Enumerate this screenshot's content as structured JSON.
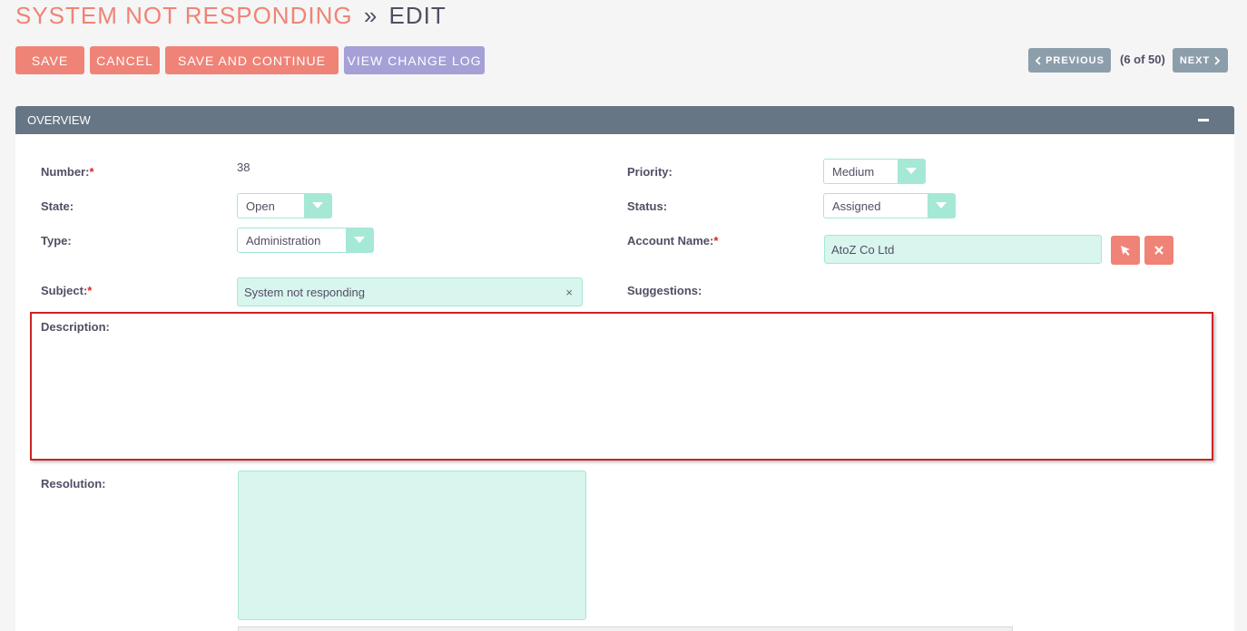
{
  "title": {
    "module": "SYSTEM NOT RESPONDING",
    "separator": "»",
    "action": "EDIT"
  },
  "actions": {
    "save": "SAVE",
    "cancel": "CANCEL",
    "save_continue": "SAVE AND CONTINUE",
    "change_log": "VIEW CHANGE LOG"
  },
  "pagination": {
    "previous": "PREVIOUS",
    "count": "(6 of 50)",
    "next": "NEXT"
  },
  "panel": {
    "title": "OVERVIEW"
  },
  "fields": {
    "number": {
      "label": "Number:",
      "required": "*",
      "value": "38"
    },
    "priority": {
      "label": "Priority:",
      "value": "Medium"
    },
    "state": {
      "label": "State:",
      "value": "Open"
    },
    "status": {
      "label": "Status:",
      "value": "Assigned"
    },
    "type": {
      "label": "Type:",
      "value": "Administration"
    },
    "account_name": {
      "label": "Account Name:",
      "required": "*",
      "value": "AtoZ Co Ltd"
    },
    "subject": {
      "label": "Subject:",
      "required": "*",
      "value": "System not responding",
      "clear": "×"
    },
    "suggestions": {
      "label": "Suggestions:"
    },
    "description": {
      "label": "Description:"
    },
    "resolution": {
      "label": "Resolution:",
      "value": ""
    }
  },
  "icons": {
    "select": "cursor-arrow-icon",
    "clear": "close-icon",
    "dropdown": "chevron-down-icon",
    "collapse": "minus-icon"
  },
  "colors": {
    "accent": "#f08377",
    "secondary": "#a5a0d6",
    "header": "#667685",
    "field_bg": "#d8f5ee",
    "field_border": "#a5e8d6",
    "highlight": "#cc2222"
  }
}
